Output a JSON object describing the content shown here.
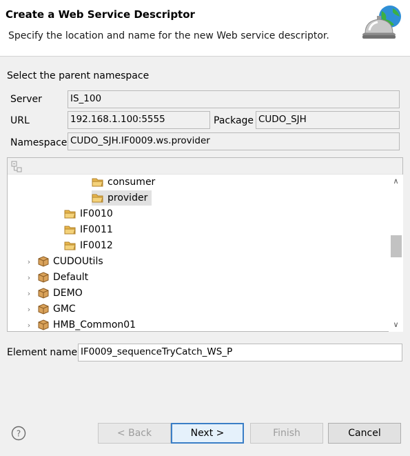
{
  "banner": {
    "title": "Create a Web Service Descriptor",
    "description": "Specify the location and name for the new Web service descriptor.",
    "icon": "service-bell-globe-icon"
  },
  "section_label": "Select the parent namespace",
  "fields": {
    "server_label": "Server",
    "server_value": "IS_100",
    "url_label": "URL",
    "url_value": "192.168.1.100:5555",
    "package_label": "Package",
    "package_value": "CUDO_SJH",
    "namespace_label": "Namespace",
    "namespace_value": "CUDO_SJH.IF0009.ws.provider"
  },
  "tree": {
    "toolbar_icon": "collapse-all-icon",
    "items": [
      {
        "label": "consumer",
        "type": "folder",
        "expandable": false,
        "selected": false
      },
      {
        "label": "provider",
        "type": "folder",
        "expandable": false,
        "selected": true
      },
      {
        "label": "IF0010",
        "type": "folder",
        "expandable": false,
        "selected": false
      },
      {
        "label": "IF0011",
        "type": "folder",
        "expandable": false,
        "selected": false
      },
      {
        "label": "IF0012",
        "type": "folder",
        "expandable": false,
        "selected": false
      },
      {
        "label": "CUDOUtils",
        "type": "package",
        "expandable": true,
        "selected": false
      },
      {
        "label": "Default",
        "type": "package",
        "expandable": true,
        "selected": false
      },
      {
        "label": "DEMO",
        "type": "package",
        "expandable": true,
        "selected": false
      },
      {
        "label": "GMC",
        "type": "package",
        "expandable": true,
        "selected": false
      },
      {
        "label": "HMB_Common01",
        "type": "package",
        "expandable": true,
        "selected": false
      }
    ]
  },
  "element_name": {
    "label": "Element name",
    "value": "IF0009_sequenceTryCatch_WS_P"
  },
  "buttons": {
    "back": "< Back",
    "next": "Next >",
    "finish": "Finish",
    "cancel": "Cancel"
  },
  "colors": {
    "folder": "#e8b64c",
    "package": "#c98b3d",
    "default_button_border": "#3a7ec6"
  }
}
